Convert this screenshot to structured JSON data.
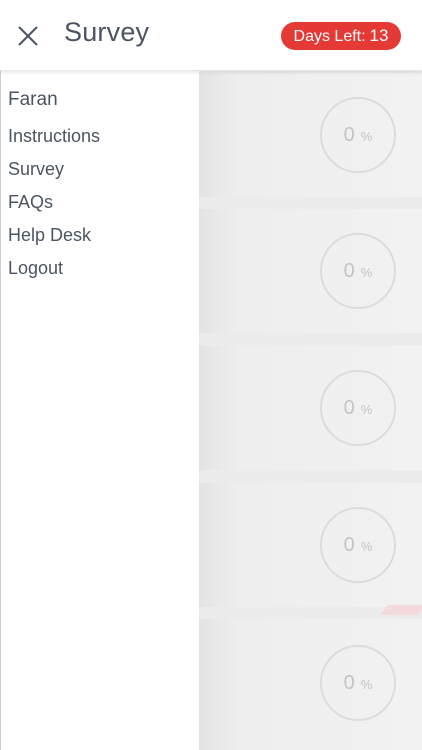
{
  "header": {
    "close_icon": "close-icon",
    "title": "Survey",
    "days_left_label": "Days Left:",
    "days_left_value": "13",
    "badge_color": "#e53935"
  },
  "drawer": {
    "user_name": "Faran",
    "items": [
      {
        "label": "Instructions"
      },
      {
        "label": "Survey"
      },
      {
        "label": "FAQs"
      },
      {
        "label": "Help Desk"
      },
      {
        "label": "Logout"
      }
    ]
  },
  "progress_cards": [
    {
      "value": "0",
      "unit": "%"
    },
    {
      "value": "0",
      "unit": "%"
    },
    {
      "value": "0",
      "unit": "%"
    },
    {
      "value": "0",
      "unit": "%"
    },
    {
      "value": "0",
      "unit": "%"
    }
  ]
}
